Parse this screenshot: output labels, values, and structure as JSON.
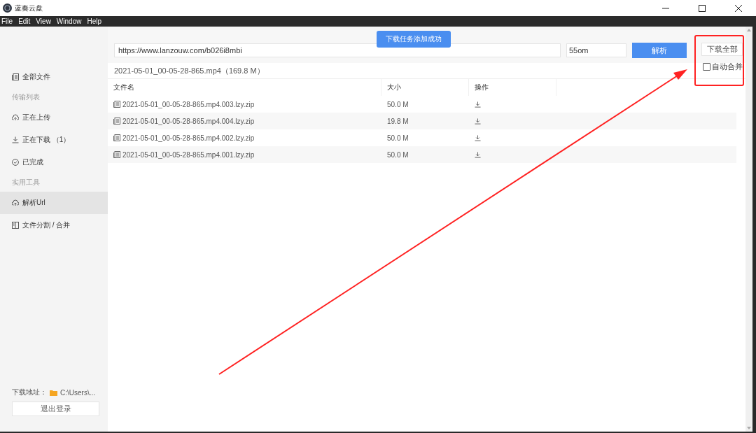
{
  "window": {
    "title": "蓝奏云盘"
  },
  "menu": [
    "File",
    "Edit",
    "View",
    "Window",
    "Help"
  ],
  "sidebar": {
    "items": [
      {
        "kind": "item",
        "label": "全部文件",
        "selected": false
      },
      {
        "kind": "heading",
        "label": "传输列表"
      },
      {
        "kind": "item",
        "label": "正在上传",
        "selected": false
      },
      {
        "kind": "item",
        "label": "正在下载 （1）",
        "selected": false
      },
      {
        "kind": "item",
        "label": "已完成",
        "selected": false
      },
      {
        "kind": "heading",
        "label": "实用工具"
      },
      {
        "kind": "item",
        "label": "解析Url",
        "selected": true
      },
      {
        "kind": "item",
        "label": "文件分割 / 合并",
        "selected": false
      }
    ],
    "download_path_label": "下载地址：",
    "download_path": "C:\\Users\\...",
    "logout_button": "退出登录"
  },
  "toast": "下载任务添加成功",
  "url_input": {
    "value": "https://www.lanzouw.com/b026i8mbi"
  },
  "code_input": {
    "value": "55om"
  },
  "parse_button": "解析",
  "download_all_button": "下载全部",
  "auto_merge": {
    "label": "自动合并",
    "checked": false
  },
  "file_title": "2021-05-01_00-05-28-865.mp4（169.8 M）",
  "table": {
    "columns": [
      "文件名",
      "大小",
      "操作"
    ],
    "rows": [
      {
        "name": "2021-05-01_00-05-28-865.mp4.003.lzy.zip",
        "size": "50.0 M"
      },
      {
        "name": "2021-05-01_00-05-28-865.mp4.004.lzy.zip",
        "size": "19.8 M"
      },
      {
        "name": "2021-05-01_00-05-28-865.mp4.002.lzy.zip",
        "size": "50.0 M"
      },
      {
        "name": "2021-05-01_00-05-28-865.mp4.001.lzy.zip",
        "size": "50.0 M"
      }
    ]
  }
}
